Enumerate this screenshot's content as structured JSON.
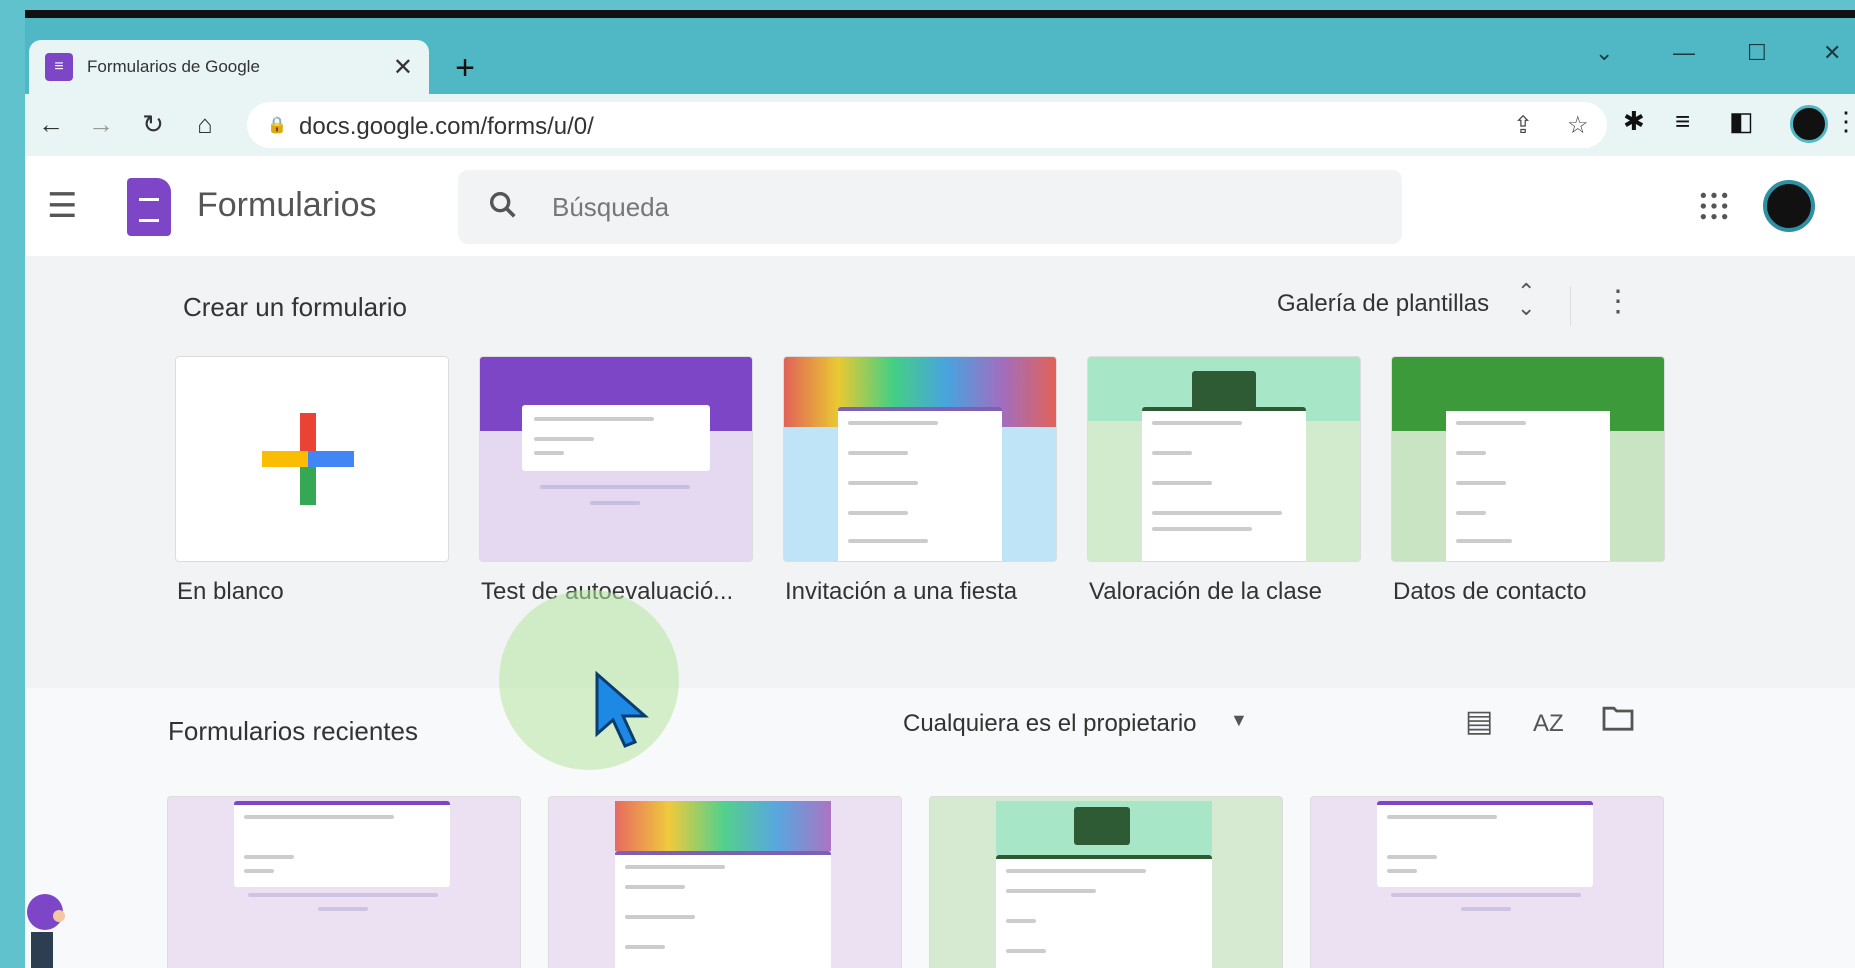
{
  "browser": {
    "tab_title": "Formularios de Google",
    "tab_close": "✕",
    "new_tab": "+",
    "url": "docs.google.com/forms/u/0/",
    "window_controls": [
      "⌄",
      "—",
      "☐",
      "✕"
    ]
  },
  "app": {
    "name": "Formularios",
    "search_placeholder": "Búsqueda"
  },
  "create": {
    "title": "Crear un formulario",
    "gallery_label": "Galería de plantillas",
    "templates": [
      {
        "label": "En blanco"
      },
      {
        "label": "Test de autoevaluació..."
      },
      {
        "label": "Invitación a una fiesta"
      },
      {
        "label": "Valoración de la clase"
      },
      {
        "label": "Datos de contacto"
      }
    ]
  },
  "recent": {
    "title": "Formularios recientes",
    "owner_filter": "Cualquiera es el propietario",
    "sort_label": "AZ"
  },
  "colors": {
    "forms_purple": "#7d46c6",
    "chrome_teal": "#4fb8c4"
  }
}
